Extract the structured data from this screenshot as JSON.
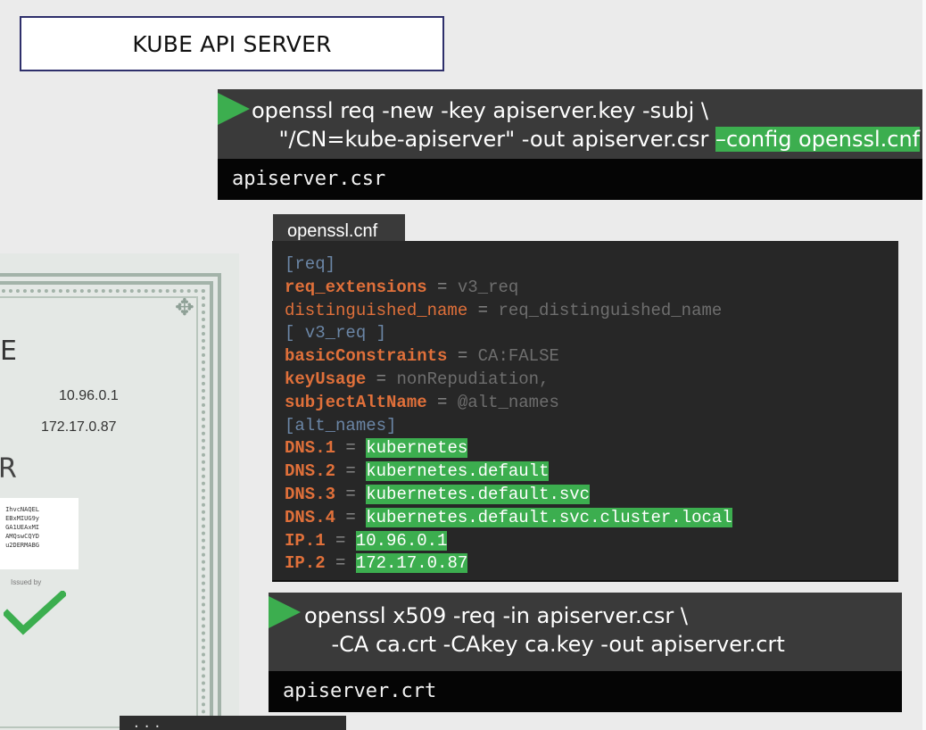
{
  "title": "KUBE API SERVER",
  "command1": {
    "line1": "openssl req -new -key apiserver.key -subj \\",
    "line2_prefix": "    \"/CN=kube-apiserver\" -out apiserver.csr ",
    "line2_highlight": "–config openssl.cnf",
    "output": "apiserver.csr"
  },
  "certificate": {
    "big_letter_1": "E",
    "big_letter_2": "R",
    "ip1": "10.96.0.1",
    "ip2": "172.17.0.87",
    "code_lines": [
      "IhvcNAQEL",
      "EBxMIUG9y",
      "GA1UEAxMI",
      "AMQswCQYD",
      "u2DERMABG"
    ],
    "issued_by": "Issued by"
  },
  "config": {
    "tab": "openssl.cnf",
    "colors": {
      "header": "#6b86a6",
      "key": "#e0703a",
      "value": "#6e6e6e",
      "eq": "#8a8a8a",
      "highlight": "#3cae4f"
    },
    "lines": [
      {
        "key": "[req]",
        "sep": "",
        "value": "",
        "style": "header"
      },
      {
        "key": "req_extensions",
        "sep": " = ",
        "value": "v3_req",
        "style": "bold"
      },
      {
        "key": "distinguished_name",
        "sep": " = ",
        "value": "req_distinguished_name",
        "style": "normal"
      },
      {
        "key": "[ v3_req ]",
        "sep": "",
        "value": "",
        "style": "header"
      },
      {
        "key": "basicConstraints",
        "sep": " = ",
        "value": "CA:FALSE",
        "style": "bold"
      },
      {
        "key": "keyUsage",
        "sep": " = ",
        "value": "nonRepudiation,",
        "style": "bold"
      },
      {
        "key": "subjectAltName",
        "sep": " = ",
        "value": "@alt_names",
        "style": "bold"
      },
      {
        "key": "[alt_names]",
        "sep": "",
        "value": "",
        "style": "header"
      },
      {
        "key": "DNS.1",
        "sep": " = ",
        "value": "kubernetes",
        "style": "highlight"
      },
      {
        "key": "DNS.2",
        "sep": " = ",
        "value": "kubernetes.default",
        "style": "highlight"
      },
      {
        "key": "DNS.3",
        "sep": " = ",
        "value": "kubernetes.default.svc",
        "style": "highlight"
      },
      {
        "key": "DNS.4",
        "sep": " = ",
        "value": "kubernetes.default.svc.cluster.local",
        "style": "highlight"
      },
      {
        "key": "IP.1",
        "sep": " = ",
        "value": "10.96.0.1",
        "style": "highlight"
      },
      {
        "key": "IP.2",
        "sep": " = ",
        "value": "172.17.0.87",
        "style": "highlight"
      }
    ]
  },
  "command2": {
    "line1": "openssl x509 -req -in apiserver.csr \\",
    "line2": "    -CA ca.crt -CAkey ca.key -out apiserver.crt",
    "output": "apiserver.crt"
  },
  "bottom_chip": "···"
}
